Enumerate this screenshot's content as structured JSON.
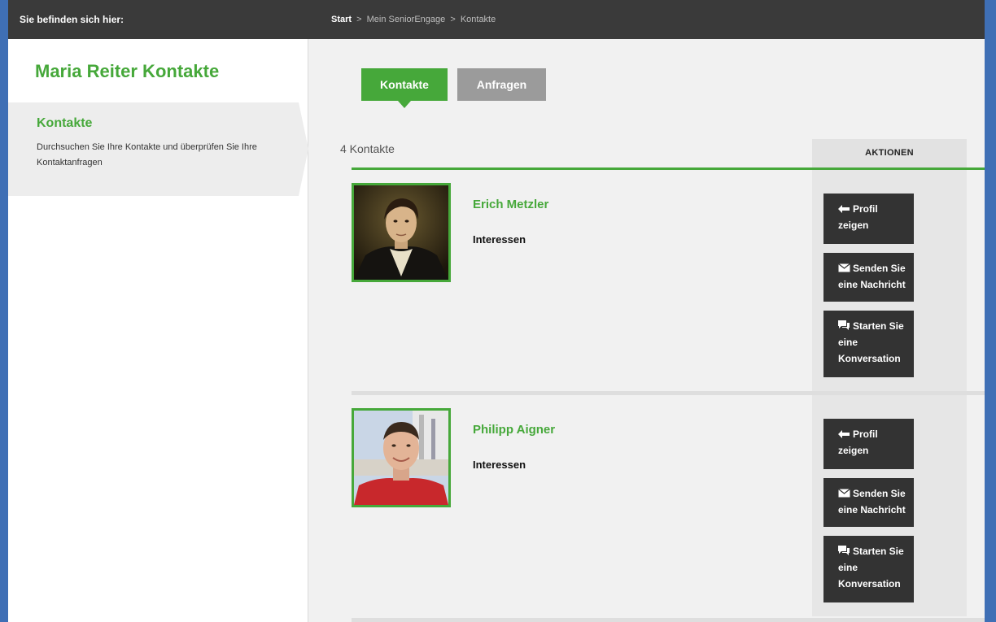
{
  "topbar": {
    "you_are_here": "Sie befinden sich hier:",
    "breadcrumb": [
      "Start",
      "Mein SeniorEngage",
      "Kontakte"
    ],
    "separator": ">"
  },
  "sidebar": {
    "title": "Maria Reiter Kontakte",
    "nav_label": "Kontakte",
    "nav_desc": "Durchsuchen Sie Ihre Kontakte und überprüfen Sie Ihre Kontaktanfragen"
  },
  "tabs": {
    "contacts": "Kontakte",
    "requests": "Anfragen"
  },
  "list": {
    "count": "4 Kontakte",
    "actions_header": "AKTIONEN"
  },
  "contacts": [
    {
      "name": "Erich Metzler",
      "interests_label": "Interessen"
    },
    {
      "name": "Philipp Aigner",
      "interests_label": "Interessen"
    }
  ],
  "buttons": {
    "profile_1": "Profil",
    "profile_2": "zeigen",
    "message_1": "Senden Sie",
    "message_2": "eine Nachricht",
    "conv_1": "Starten Sie",
    "conv_2": "eine",
    "conv_3": "Konversation"
  },
  "colors": {
    "accent": "#46a83a",
    "dark": "#333333",
    "frame": "#3f6fb5"
  },
  "icons": {
    "profile": "arrow-left-icon",
    "message": "envelope-icon",
    "conversation": "speech-bubble-icon"
  }
}
